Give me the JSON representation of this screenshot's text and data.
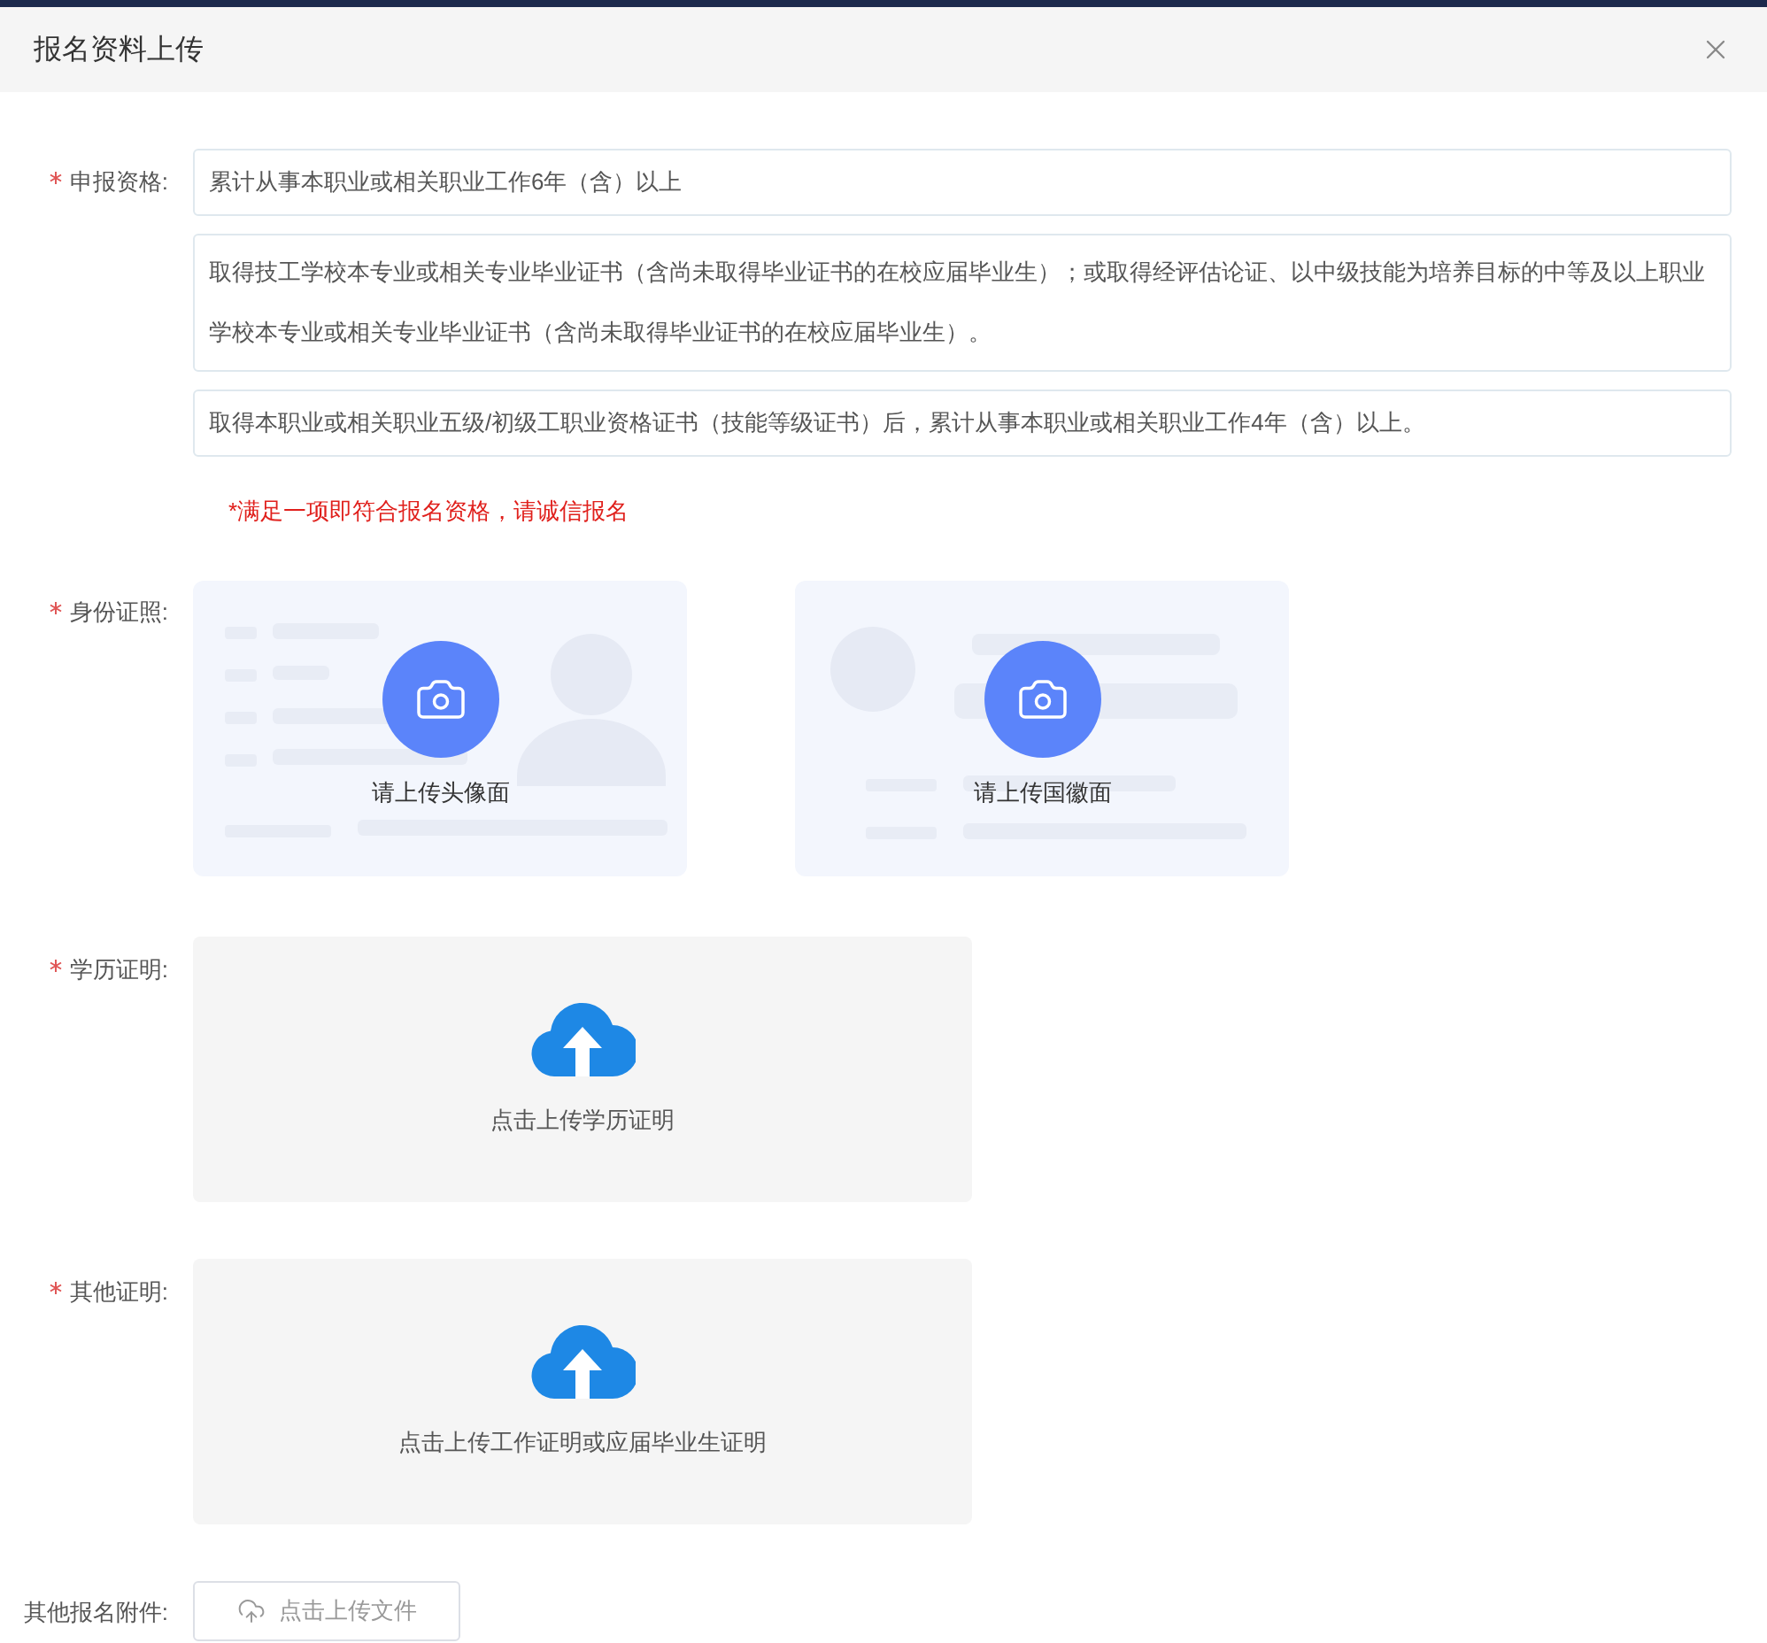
{
  "dialog": {
    "title": "报名资料上传"
  },
  "fields": [
    {
      "kind": "qualification",
      "label": "申报资格:",
      "required": true,
      "options": [
        "累计从事本职业或相关职业工作6年（含）以上",
        "取得技工学校本专业或相关专业毕业证书（含尚未取得毕业证书的在校应届毕业生）；或取得经评估论证、以中级技能为培养目标的中等及以上职业学校本专业或相关专业毕业证书（含尚未取得毕业证书的在校应届毕业生）。",
        "取得本职业或相关职业五级/初级工职业资格证书（技能等级证书）后，累计从事本职业或相关职业工作4年（含）以上。"
      ],
      "note": "*满足一项即符合报名资格，请诚信报名"
    },
    {
      "kind": "id_card",
      "label": "身份证照:",
      "required": true,
      "slots": [
        {
          "kind": "front",
          "caption": "请上传头像面"
        },
        {
          "kind": "back",
          "caption": "请上传国徽面"
        }
      ]
    },
    {
      "kind": "dropzone",
      "label": "学历证明:",
      "required": true,
      "caption": "点击上传学历证明"
    },
    {
      "kind": "dropzone",
      "label": "其他证明:",
      "required": true,
      "caption": "点击上传工作证明或应届毕业生证明"
    },
    {
      "kind": "button",
      "label": "其他报名附件:",
      "required": false,
      "button": "点击上传文件"
    }
  ]
}
